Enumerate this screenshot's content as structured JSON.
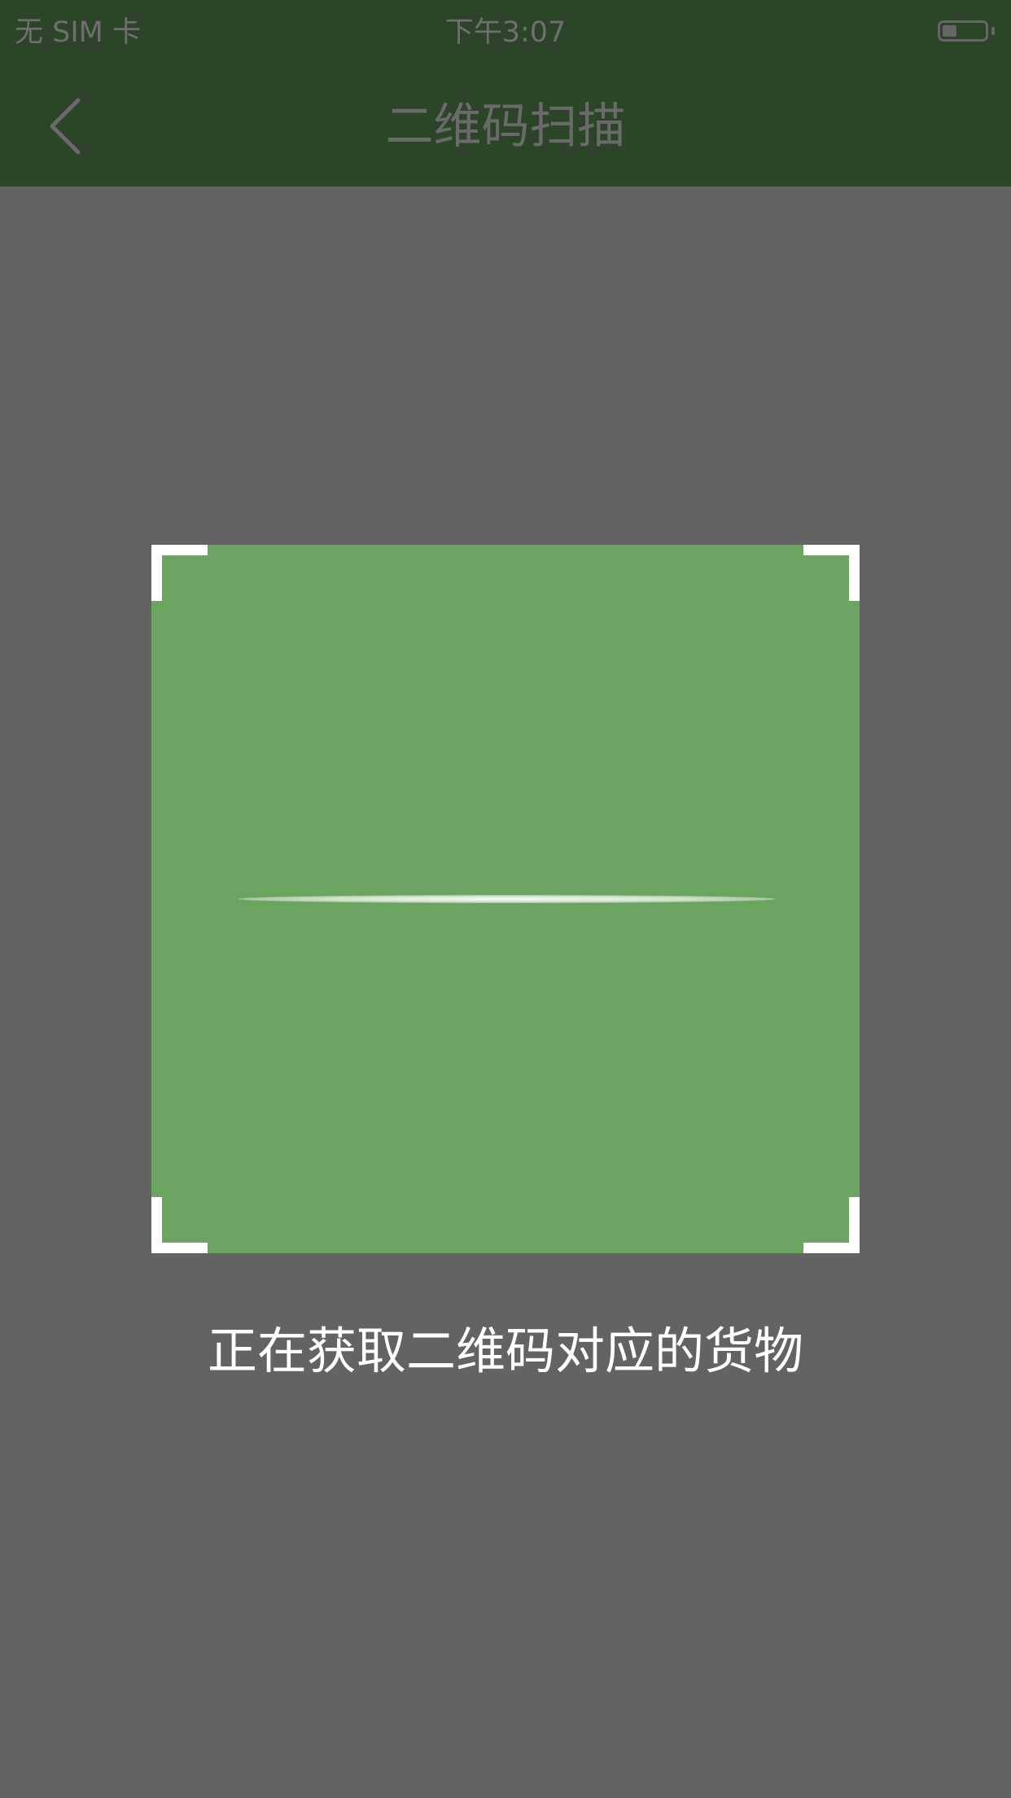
{
  "status_bar": {
    "carrier": "无 SIM 卡",
    "time": "下午3:07",
    "battery_level": 0.25
  },
  "nav": {
    "back_icon": "chevron-left-icon",
    "title": "二维码扫描"
  },
  "scanner": {
    "message": "正在获取二维码对应的货物"
  },
  "colors": {
    "nav_background": "#2c4529",
    "page_background": "#636363",
    "scan_area": "#6aa460",
    "corner_marks": "#ffffff",
    "message_text": "#ffffff"
  }
}
